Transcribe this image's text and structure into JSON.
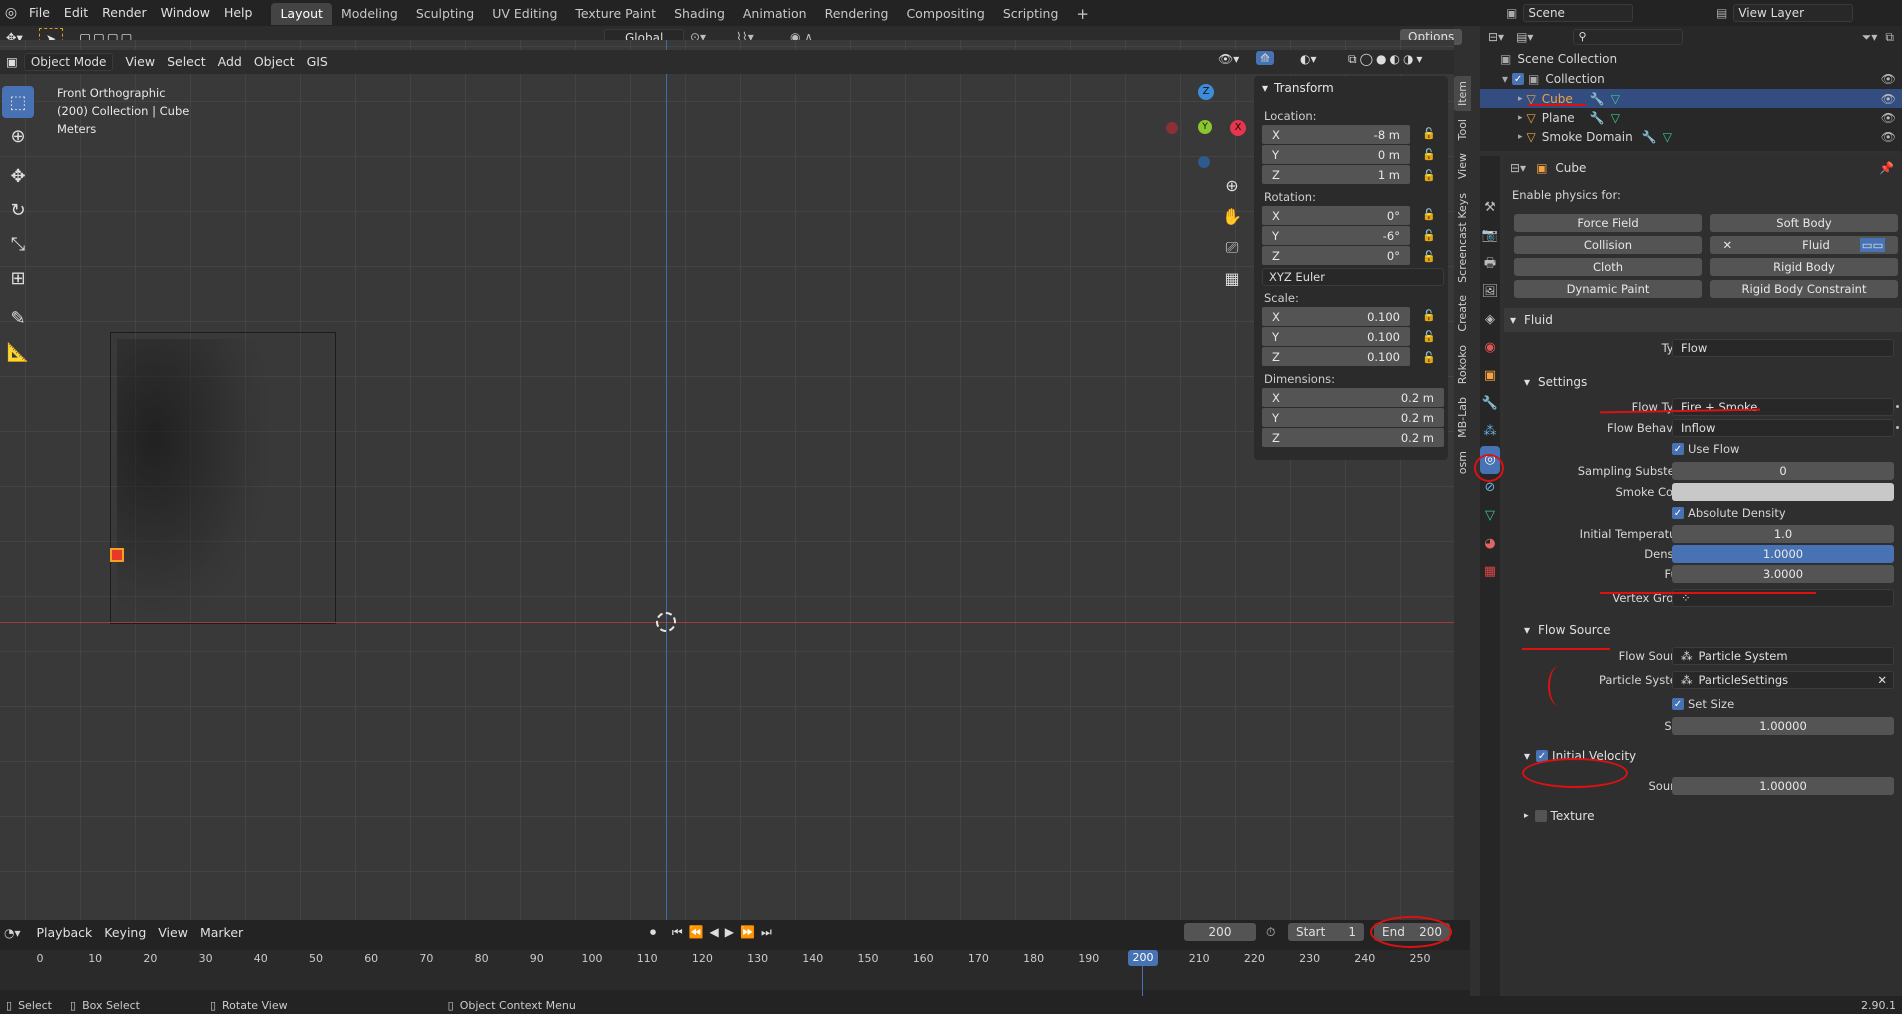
{
  "topbar": {
    "menus": [
      "File",
      "Edit",
      "Render",
      "Window",
      "Help"
    ],
    "workspaces": [
      "Layout",
      "Modeling",
      "Sculpting",
      "UV Editing",
      "Texture Paint",
      "Shading",
      "Animation",
      "Rendering",
      "Compositing",
      "Scripting"
    ],
    "active_workspace": "Layout",
    "scene": "Scene",
    "view_layer": "View Layer"
  },
  "viewport": {
    "header": {
      "mode": "Object Mode",
      "menus": [
        "View",
        "Select",
        "Add",
        "Object",
        "GIS"
      ],
      "transform_orientation": "Global",
      "options": "Options"
    },
    "overlay_text": [
      "Front Orthographic",
      "(200) Collection | Cube",
      "Meters"
    ],
    "gizmo_axes": {
      "z": "Z",
      "y": "Y",
      "x": "X"
    }
  },
  "npanel": {
    "title": "Transform",
    "location_label": "Location:",
    "location": [
      {
        "axis": "X",
        "value": "-8 m"
      },
      {
        "axis": "Y",
        "value": "0 m"
      },
      {
        "axis": "Z",
        "value": "1 m"
      }
    ],
    "rotation_label": "Rotation:",
    "rotation": [
      {
        "axis": "X",
        "value": "0°"
      },
      {
        "axis": "Y",
        "value": "-6°"
      },
      {
        "axis": "Z",
        "value": "0°"
      }
    ],
    "rotation_mode": "XYZ Euler",
    "scale_label": "Scale:",
    "scale": [
      {
        "axis": "X",
        "value": "0.100"
      },
      {
        "axis": "Y",
        "value": "0.100"
      },
      {
        "axis": "Z",
        "value": "0.100"
      }
    ],
    "dimensions_label": "Dimensions:",
    "dimensions": [
      {
        "axis": "X",
        "value": "0.2 m"
      },
      {
        "axis": "Y",
        "value": "0.2 m"
      },
      {
        "axis": "Z",
        "value": "0.2 m"
      }
    ],
    "side_tabs": [
      "Item",
      "Tool",
      "View",
      "Screencast Keys",
      "Create",
      "Rokoko",
      "MB-Lab",
      "osm"
    ]
  },
  "outliner": {
    "root": "Scene Collection",
    "collection": "Collection",
    "items": [
      "Cube",
      "Plane",
      "Smoke Domain"
    ]
  },
  "properties": {
    "object_name": "Cube",
    "physics_header": "Enable physics for:",
    "physics_buttons": [
      "Force Field",
      "Soft Body",
      "Collision",
      "Fluid",
      "Cloth",
      "Rigid Body",
      "Dynamic Paint",
      "Rigid Body Constraint"
    ],
    "fluid_panel": "Fluid",
    "type_label": "Type",
    "type_value": "Flow",
    "settings_panel": "Settings",
    "flow_type_label": "Flow Type",
    "flow_type": "Fire + Smoke",
    "flow_behavior_label": "Flow Behavior",
    "flow_behavior": "Inflow",
    "use_flow": "Use Flow",
    "sampling_label": "Sampling Substeps",
    "sampling": "0",
    "smoke_color_label": "Smoke Color",
    "absolute_density": "Absolute Density",
    "init_temp_label": "Initial Temperature",
    "init_temp": "1.0",
    "density_label": "Density",
    "density": "1.0000",
    "fuel_label": "Fuel",
    "fuel": "3.0000",
    "vertex_group_label": "Vertex Group",
    "flow_source_panel": "Flow Source",
    "flow_source_label": "Flow Source",
    "flow_source": "Particle System",
    "particle_system_label": "Particle System",
    "particle_system": "ParticleSettings",
    "set_size": "Set Size",
    "size_label": "Size",
    "size": "1.00000",
    "initial_velocity_panel": "Initial Velocity",
    "source_label": "Source",
    "source": "1.00000",
    "texture_panel": "Texture"
  },
  "timeline": {
    "menus": [
      "Playback",
      "Keying",
      "View",
      "Marker"
    ],
    "current_frame": "200",
    "start_label": "Start",
    "start": "1",
    "end_label": "End",
    "end": "200",
    "ticks": [
      "0",
      "10",
      "20",
      "30",
      "40",
      "50",
      "60",
      "70",
      "80",
      "90",
      "100",
      "110",
      "120",
      "130",
      "140",
      "150",
      "160",
      "170",
      "180",
      "190",
      "200",
      "210",
      "220",
      "230",
      "240",
      "250"
    ]
  },
  "statusbar": {
    "select": "Select",
    "box_select": "Box Select",
    "rotate_view": "Rotate View",
    "context_menu": "Object Context Menu",
    "version": "2.90.1"
  },
  "colors": {
    "accent": "#4772b3",
    "selected_row": "#334d80",
    "x_axis": "#e8344c",
    "y_axis": "#8ac72f",
    "z_axis": "#3b8ddb",
    "annotation": "#dd1111"
  }
}
